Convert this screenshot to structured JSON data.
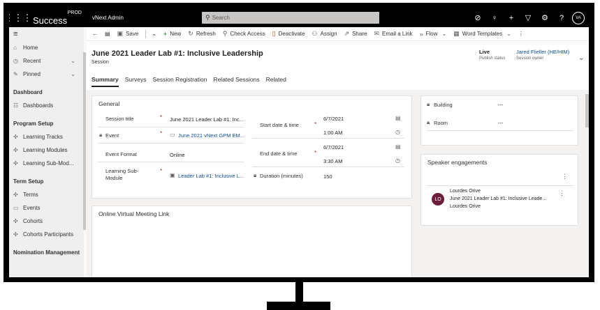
{
  "topbar": {
    "env": "PROD",
    "brand": "Success Hub",
    "app_name": "vNext Admin",
    "search_placeholder": "Search",
    "avatar": "VA"
  },
  "sidebar": {
    "top_items": [
      {
        "label": "Home",
        "icon": "home-icon"
      },
      {
        "label": "Recent",
        "icon": "clock-icon"
      },
      {
        "label": "Pinned",
        "icon": "pin-icon"
      }
    ],
    "sections": [
      {
        "title": "Dashboard",
        "items": [
          {
            "label": "Dashboards"
          }
        ]
      },
      {
        "title": "Program Setup",
        "items": [
          {
            "label": "Learning Tracks"
          },
          {
            "label": "Learning Modules"
          },
          {
            "label": "Learning Sub-Mod..."
          }
        ]
      },
      {
        "title": "Term Setup",
        "items": [
          {
            "label": "Terms"
          },
          {
            "label": "Events"
          },
          {
            "label": "Cohorts"
          },
          {
            "label": "Cohorts Participants"
          }
        ]
      },
      {
        "title": "Nomination Management",
        "items": []
      }
    ]
  },
  "commands": {
    "save": "Save",
    "new": "New",
    "refresh": "Refresh",
    "check_access": "Check Access",
    "deactivate": "Deactivate",
    "assign": "Assign",
    "share": "Share",
    "email_link": "Email a Link",
    "flow": "Flow",
    "word_templates": "Word Templates"
  },
  "record": {
    "title": "June 2021 Leader Lab #1: Inclusive Leadership",
    "entity": "Session",
    "publish_status_value": "Live",
    "publish_status_label": "Publish status",
    "owner_value": "Jared Flieller (HE/HIM)",
    "owner_label": "Session owner"
  },
  "tabs": [
    "Summary",
    "Surveys",
    "Session Registration",
    "Related Sessions",
    "Related"
  ],
  "general": {
    "title": "General",
    "session_title_label": "Session title",
    "session_title_value": "June 2021 Leader Lab #1: Inc...",
    "event_label": "Event",
    "event_value": "June 2021 vNext GPM EM...",
    "format_label": "Event Format",
    "format_value": "Online",
    "submodule_label_1": "Learning Sub-",
    "submodule_label_2": "Module",
    "submodule_value": "Leader Lab #1: Inclusive L...",
    "start_label": "Start date & time",
    "start_date": "6/7/2021",
    "start_time": "1:00 AM",
    "end_label": "End date & time",
    "end_date": "6/7/2021",
    "end_time": "3:30 AM",
    "duration_label": "Duration (minutes)",
    "duration_value": "150"
  },
  "location": {
    "building_label": "Building",
    "building_value": "---",
    "room_label": "Room",
    "room_value": "---"
  },
  "online": {
    "title": "Online Virtual Meeting Link"
  },
  "speakers": {
    "title": "Speaker engagements",
    "item": {
      "initials": "LO",
      "name": "Lourdes Orive",
      "session": "June 2021 Leader Lab #1: Inclusive Leade...",
      "speaker": "Lourdes Orive"
    }
  }
}
